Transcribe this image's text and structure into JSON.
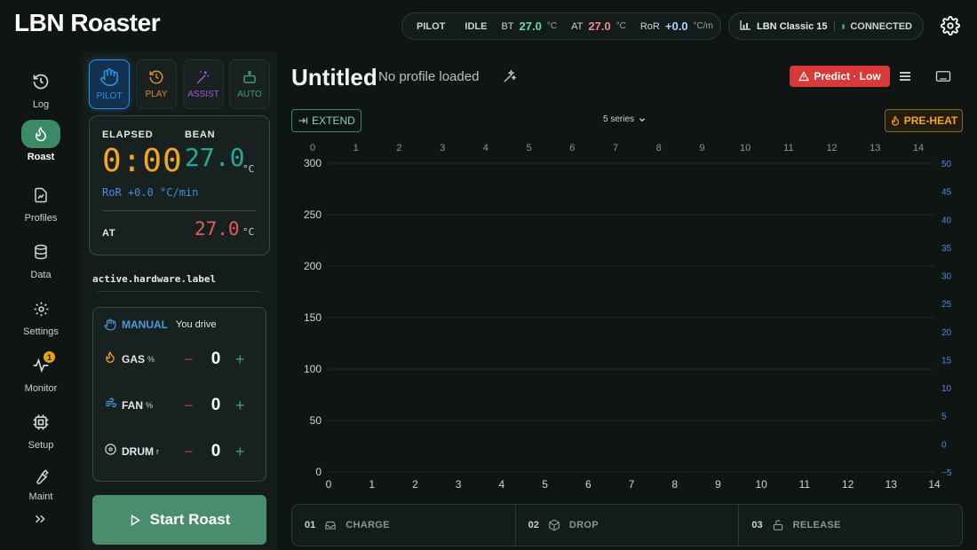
{
  "app": {
    "title": "LBN Roaster"
  },
  "status": {
    "mode": "PILOT",
    "state": "IDLE",
    "bt_label": "BT",
    "bt_value": "27.0",
    "bt_unit": "°C",
    "at_label": "AT",
    "at_value": "27.0",
    "at_unit": "°C",
    "ror_label": "RoR",
    "ror_value": "+0.0",
    "ror_unit": "°C/m"
  },
  "device": {
    "name": "LBN Classic 15",
    "connection": "CONNECTED"
  },
  "sidebar": {
    "items": [
      {
        "label": "Log",
        "icon": "history-icon"
      },
      {
        "label": "Roast",
        "icon": "flame-icon",
        "active": true
      },
      {
        "label": "Profiles",
        "icon": "chart-file-icon"
      },
      {
        "label": "Data",
        "icon": "database-icon"
      },
      {
        "label": "Settings",
        "icon": "gear-icon"
      },
      {
        "label": "Monitor",
        "icon": "pulse-icon",
        "badge": "1"
      },
      {
        "label": "Setup",
        "icon": "chip-icon"
      },
      {
        "label": "Maint",
        "icon": "wrench-icon"
      }
    ],
    "expand_icon": "chevrons-right-icon"
  },
  "modes": [
    {
      "label": "PILOT",
      "color": "#2b8fe0",
      "active": true
    },
    {
      "label": "PLAY",
      "color": "#e08a2a"
    },
    {
      "label": "ASSIST",
      "color": "#9a58e0"
    },
    {
      "label": "AUTO",
      "color": "#3aa07a"
    }
  ],
  "readout": {
    "elapsed_label": "ELAPSED",
    "elapsed_value": "0:00",
    "bean_label": "BEAN",
    "bean_value": "27.0",
    "bean_unit": "°C",
    "ror_line": "RoR +0.0 °C/min",
    "at_label": "AT",
    "at_value": "27.0",
    "at_unit": "°C"
  },
  "hardware": {
    "label": "active.hardware.label"
  },
  "control": {
    "mode_label": "MANUAL",
    "mode_desc": "You drive",
    "rows": [
      {
        "name": "GAS",
        "unit": "%",
        "value": "0",
        "icon": "flame-icon"
      },
      {
        "name": "FAN",
        "unit": "%",
        "value": "0",
        "icon": "wind-icon"
      },
      {
        "name": "DRUM",
        "unit": "r",
        "value": "0",
        "icon": "disc-icon"
      }
    ],
    "minus": "−",
    "plus": "+"
  },
  "start_button": {
    "label": "Start Roast"
  },
  "profile": {
    "title": "Untitled",
    "subtitle": "No profile loaded"
  },
  "toolbar": {
    "predict_label": "Predict · Low",
    "extend_label": "EXTEND",
    "series_label": "5 series",
    "preheat_label": "PRE-HEAT"
  },
  "chart_data": {
    "type": "line",
    "x_top_ticks": [
      "0",
      "1",
      "2",
      "3",
      "4",
      "5",
      "6",
      "7",
      "8",
      "9",
      "10",
      "11",
      "12",
      "13",
      "14"
    ],
    "x_bottom_ticks": [
      "0",
      "1",
      "2",
      "3",
      "4",
      "5",
      "6",
      "7",
      "8",
      "9",
      "10",
      "11",
      "12",
      "13",
      "14"
    ],
    "y_left_ticks": [
      "300",
      "250",
      "200",
      "150",
      "100",
      "50",
      "0"
    ],
    "y_right_ticks": [
      "50",
      "45",
      "40",
      "35",
      "30",
      "25",
      "20",
      "15",
      "10",
      "5",
      "0",
      "−5"
    ],
    "xlim": [
      0,
      14
    ],
    "ylim_left": [
      0,
      300
    ],
    "ylim_right": [
      -5,
      50
    ],
    "series": [],
    "grid": true,
    "colors": {
      "left_axis": "#d0d6d4",
      "right_axis": "#4a8ae0",
      "grid": "#1e2a27"
    }
  },
  "events": [
    {
      "num": "01",
      "name": "CHARGE",
      "icon": "inbox-icon"
    },
    {
      "num": "02",
      "name": "DROP",
      "icon": "box-icon"
    },
    {
      "num": "03",
      "name": "RELEASE",
      "icon": "unlock-icon"
    }
  ]
}
